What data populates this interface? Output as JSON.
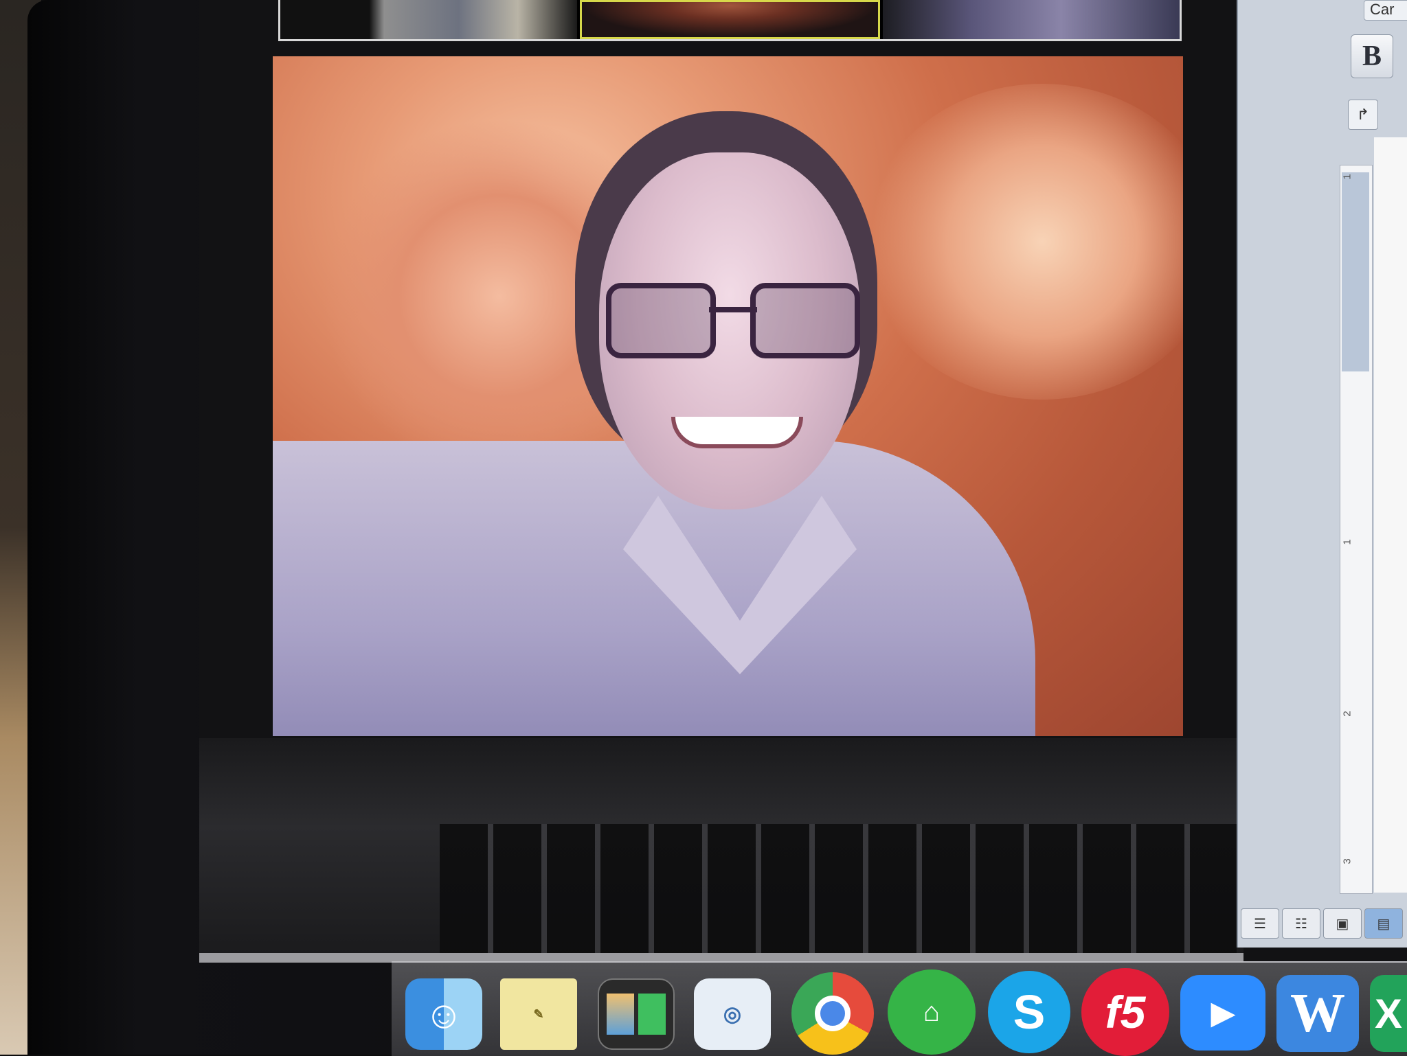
{
  "doc_window": {
    "top_button_label": "Car",
    "bold_label": "B",
    "indent_label": "↱",
    "ruler_marks": [
      "1",
      "1",
      "2",
      "3"
    ]
  },
  "dock": {
    "apps": [
      {
        "name": "finder",
        "label": ""
      },
      {
        "name": "stickies",
        "label": ""
      },
      {
        "name": "photo-booth",
        "label": ""
      },
      {
        "name": "preview",
        "label": ""
      },
      {
        "name": "chrome",
        "label": ""
      },
      {
        "name": "keynote",
        "label": ""
      },
      {
        "name": "skype",
        "label": "S"
      },
      {
        "name": "f5",
        "label": "f5"
      },
      {
        "name": "zoom",
        "label": ""
      },
      {
        "name": "word",
        "label": "W"
      },
      {
        "name": "excel",
        "label": "X"
      }
    ]
  },
  "icons": {
    "finder": "finder-face-icon",
    "zoom": "camera-icon",
    "keynote": "presentation-icon"
  }
}
